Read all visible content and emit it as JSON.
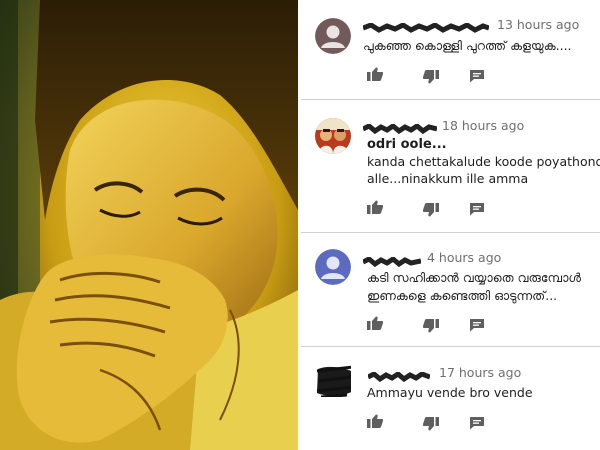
{
  "comments": [
    {
      "avatar": "default-user-avatar",
      "avatar_color": "#715a59",
      "author": "",
      "time": "13 hours ago",
      "lines": [
        "പുകഞ്ഞ കൊള്ളി പുറത്ത് കളയുക...."
      ]
    },
    {
      "avatar": "photo-avatar",
      "author": "",
      "time": "18 hours ago",
      "bold": "odri oole...",
      "lines": [
        "kanda chettakalude koode poyathond",
        "alle...ninakkum ille amma"
      ]
    },
    {
      "avatar": "default-user-avatar",
      "avatar_color": "#5c6bc0",
      "author": "",
      "time": "4 hours ago",
      "lines": [
        "കടി സഹിക്കാൻ വയ്യാതെ വരുമ്പോൾ",
        "ഇണകളെ കണ്ടെത്തി ഓടുന്നത്..."
      ]
    },
    {
      "avatar": "scribbled-avatar",
      "author": "",
      "time": "17 hours ago",
      "lines": [
        "Ammayu vende bro vende"
      ]
    }
  ],
  "actions": {
    "like": "thumbs-up-icon",
    "dislike": "thumbs-down-icon",
    "reply": "reply-comment-icon"
  },
  "colors": {
    "photo_tone": "#e8c21a",
    "meta_text": "#6f6f6f",
    "icon": "#5f5f5f"
  }
}
